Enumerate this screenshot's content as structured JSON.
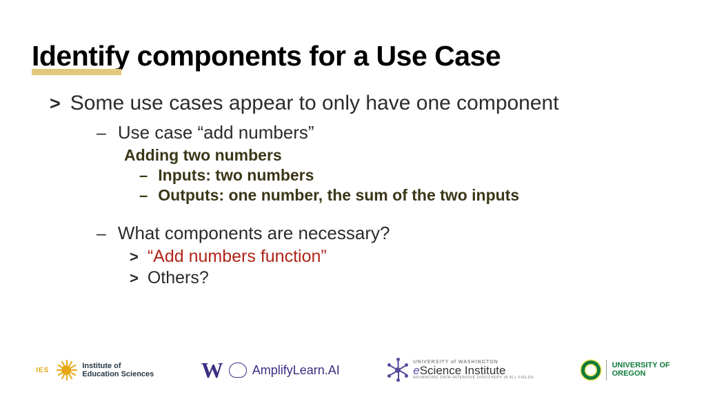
{
  "title": "Identify components for a Use Case",
  "main_bullet": "Some use cases appear to only have one component",
  "sub": {
    "use_case": "Use case “add numbers”",
    "detail_title": "Adding two numbers",
    "inputs": "Inputs: two numbers",
    "outputs": "Outputs: one number, the sum of the two inputs",
    "question": "What components are necessary?",
    "answer1": "“Add numbers function”",
    "answer2": "Others?"
  },
  "markers": {
    "chev": ">",
    "dash": "–"
  },
  "footer": {
    "ies_label": "IES",
    "ies_line1": "Institute of",
    "ies_line2": "Education Sciences",
    "w": "W",
    "amplify": "AmplifyLearn.AI",
    "esci_top": "UNIVERSITY of WASHINGTON",
    "esci_mid_e": "e",
    "esci_mid_rest": "Science Institute",
    "esci_bot": "ADVANCING DATA-INTENSIVE DISCOVERY IN ALL FIELDS",
    "uo_line1": "UNIVERSITY OF",
    "uo_line2": "OREGON"
  }
}
